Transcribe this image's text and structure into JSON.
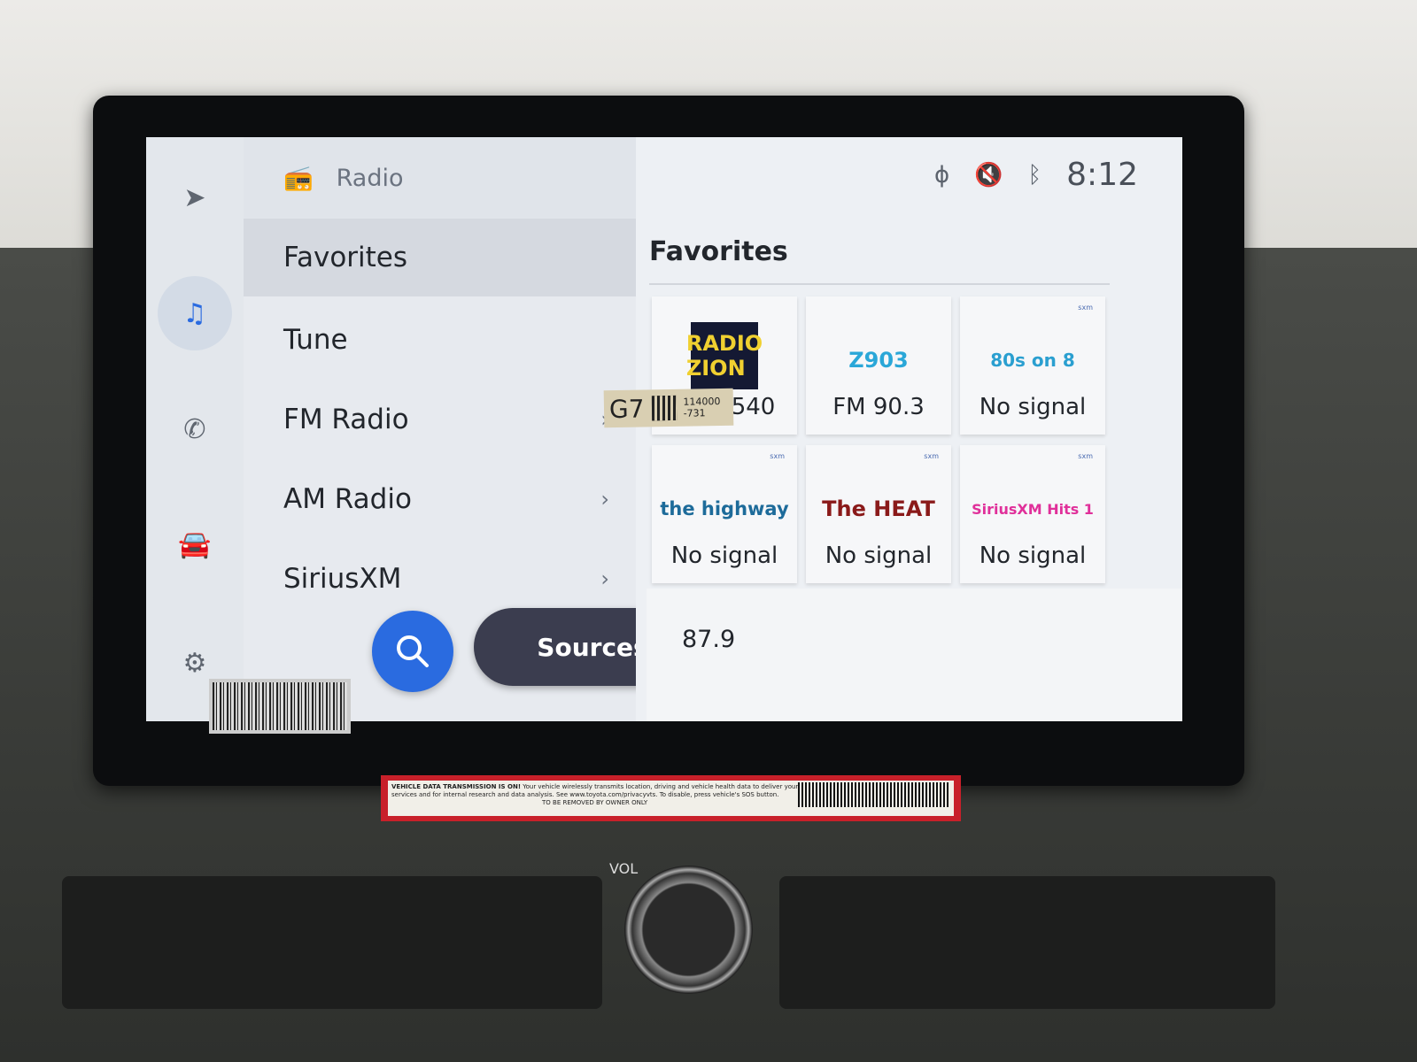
{
  "colors": {
    "accent": "#2a6be0",
    "sources_button": "#3b3d4f"
  },
  "rail": {
    "icons": [
      "navigation-icon",
      "music-icon",
      "phone-icon",
      "car-icon",
      "settings-icon"
    ],
    "active": "music-icon"
  },
  "menu": {
    "header": {
      "icon": "radio-icon",
      "title": "Radio"
    },
    "items": [
      {
        "label": "Favorites",
        "selected": true,
        "chevron": false
      },
      {
        "label": "Tune",
        "chevron": false
      },
      {
        "label": "FM Radio",
        "chevron": true
      },
      {
        "label": "AM Radio",
        "chevron": true
      },
      {
        "label": "SiriusXM",
        "chevron": true
      }
    ],
    "sources_label": "Sources"
  },
  "status": {
    "icons": [
      "voice-icon",
      "mute-icon",
      "bluetooth-icon"
    ],
    "time": "8:12"
  },
  "favorites": {
    "title": "Favorites",
    "tiles": [
      {
        "logo": "RADIO ZION",
        "label": "AM 1540",
        "siriusxm": false
      },
      {
        "logo": "Z903",
        "label": "FM 90.3",
        "siriusxm": false
      },
      {
        "logo": "80s on 8",
        "label": "No signal",
        "siriusxm": true
      },
      {
        "logo": "the highway",
        "label": "No signal",
        "siriusxm": true
      },
      {
        "logo": "The HEAT",
        "label": "No signal",
        "siriusxm": true
      },
      {
        "logo": "SiriusXM Hits 1",
        "label": "No signal",
        "siriusxm": true
      }
    ],
    "sxm_badge": "sxm"
  },
  "now_playing": {
    "frequency": "87.9"
  },
  "stickers": {
    "label_g7": {
      "code": "G7",
      "line1": "114000",
      "line2": "-731"
    },
    "red_sticker": {
      "heading": "VEHICLE DATA TRANSMISSION IS ON!",
      "body": "Your vehicle wirelessly transmits location, driving and vehicle health data to deliver your services and for internal research and data analysis. See www.toyota.com/privacyvts. To disable, press vehicle's SOS button.",
      "footer": "TO BE REMOVED BY OWNER ONLY"
    }
  },
  "console": {
    "vol_label": "VOL"
  }
}
